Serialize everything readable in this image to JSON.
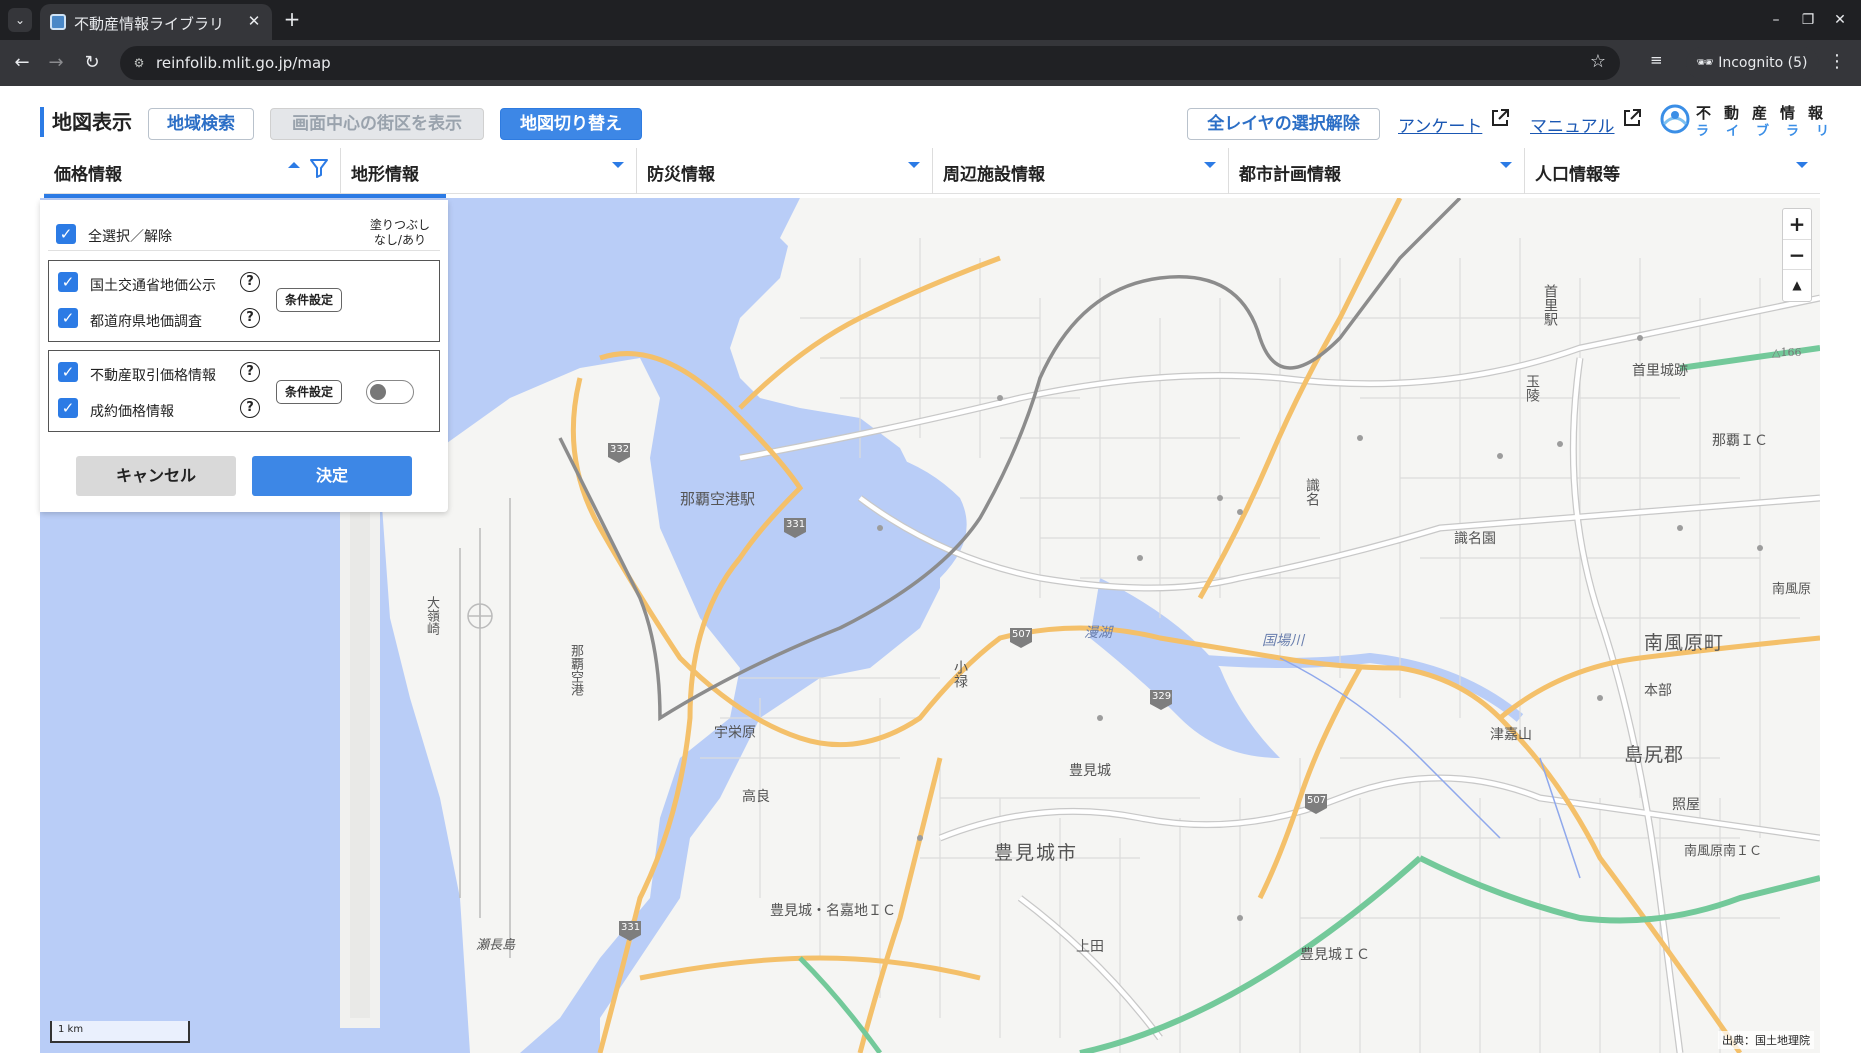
{
  "browser": {
    "tab_title": "不動産情報ライブラリ",
    "url": "reinfolib.mlit.go.jp/map",
    "incognito_label": "Incognito (5)"
  },
  "header": {
    "title": "地図表示",
    "area_search": "地域検索",
    "center_district": "画面中心の街区を表示",
    "map_switch": "地図切り替え",
    "clear_layers": "全レイヤの選択解除",
    "survey_link": "アンケート",
    "manual_link": "マニュアル",
    "logo_top": "不動産情報",
    "logo_bottom": "ライブラリ"
  },
  "layer_tabs": [
    {
      "label": "価格情報"
    },
    {
      "label": "地形情報"
    },
    {
      "label": "防災情報"
    },
    {
      "label": "周辺施設情報"
    },
    {
      "label": "都市計画情報"
    },
    {
      "label": "人口情報等"
    }
  ],
  "panel": {
    "select_all": "全選択／解除",
    "fill_note_1": "塗りつぶし",
    "fill_note_2": "なし/あり",
    "group1": [
      {
        "label": "国土交通省地価公示",
        "checked": true
      },
      {
        "label": "都道府県地価調査",
        "checked": true
      }
    ],
    "group2": [
      {
        "label": "不動産取引価格情報",
        "checked": true
      },
      {
        "label": "成約価格情報",
        "checked": true
      }
    ],
    "condition_button": "条件設定",
    "fill_toggle_on": false,
    "cancel": "キャンセル",
    "confirm": "決定"
  },
  "map": {
    "scale": "1 km",
    "attribution": "出典：国土地理院",
    "labels": {
      "naha_airport_station": "那覇空港駅",
      "uebaru": "宇栄原",
      "takara": "高良",
      "tomigusuku_city": "豊見城市",
      "tomigusuku": "豊見城",
      "tomigusuku_nakachi_ic": "豊見城・名嘉地ＩＣ",
      "ueta": "上田",
      "tomigusuku_ic": "豊見城ＩＣ",
      "senagajima": "瀬長島",
      "oominezaki": "大嶺崎",
      "naha_airport": "那覇空港",
      "koroku": "小禄",
      "manko": "漫湖",
      "kokuba_river": "国場川",
      "shikina": "識名",
      "shikinaen": "識名園",
      "shuri_castle": "首里城跡",
      "shuri_station": "首里駅",
      "tamaudun": "玉陵",
      "naha_ic": "那覇ＩＣ",
      "haebaru_town": "南風原町",
      "haebaru": "南風原",
      "motobu": "本部",
      "tsukazan": "津嘉山",
      "shimajiri": "島尻郡",
      "teruya": "照屋",
      "haebaru_minami_ic": "南風原南ＩＣ",
      "route_332": "332",
      "route_331": "331",
      "route_331b": "331",
      "route_507": "507",
      "route_507b": "507",
      "route_329": "329",
      "elev_166": "△166"
    }
  }
}
